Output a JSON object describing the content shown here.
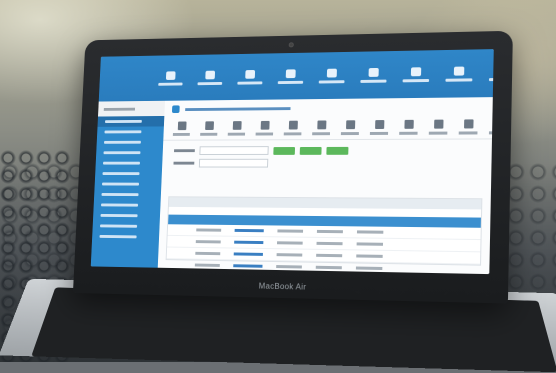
{
  "laptop": {
    "brand_label": "MacBook Air"
  },
  "app": {
    "ribbon_buttons": [
      "",
      "",
      "",
      "",
      "",
      "",
      "",
      "",
      ""
    ],
    "toolbar_buttons": [
      "",
      "",
      "",
      "",
      "",
      "",
      "",
      "",
      "",
      "",
      "",
      ""
    ],
    "sidebar_items": [
      "",
      "",
      "",
      "",
      "",
      "",
      "",
      "",
      "",
      "",
      "",
      ""
    ],
    "table_rows": 5
  },
  "colors": {
    "ribbon_blue": "#2f86c8",
    "sidebar_blue": "#2d89cc",
    "action_green": "#5cb85c"
  }
}
